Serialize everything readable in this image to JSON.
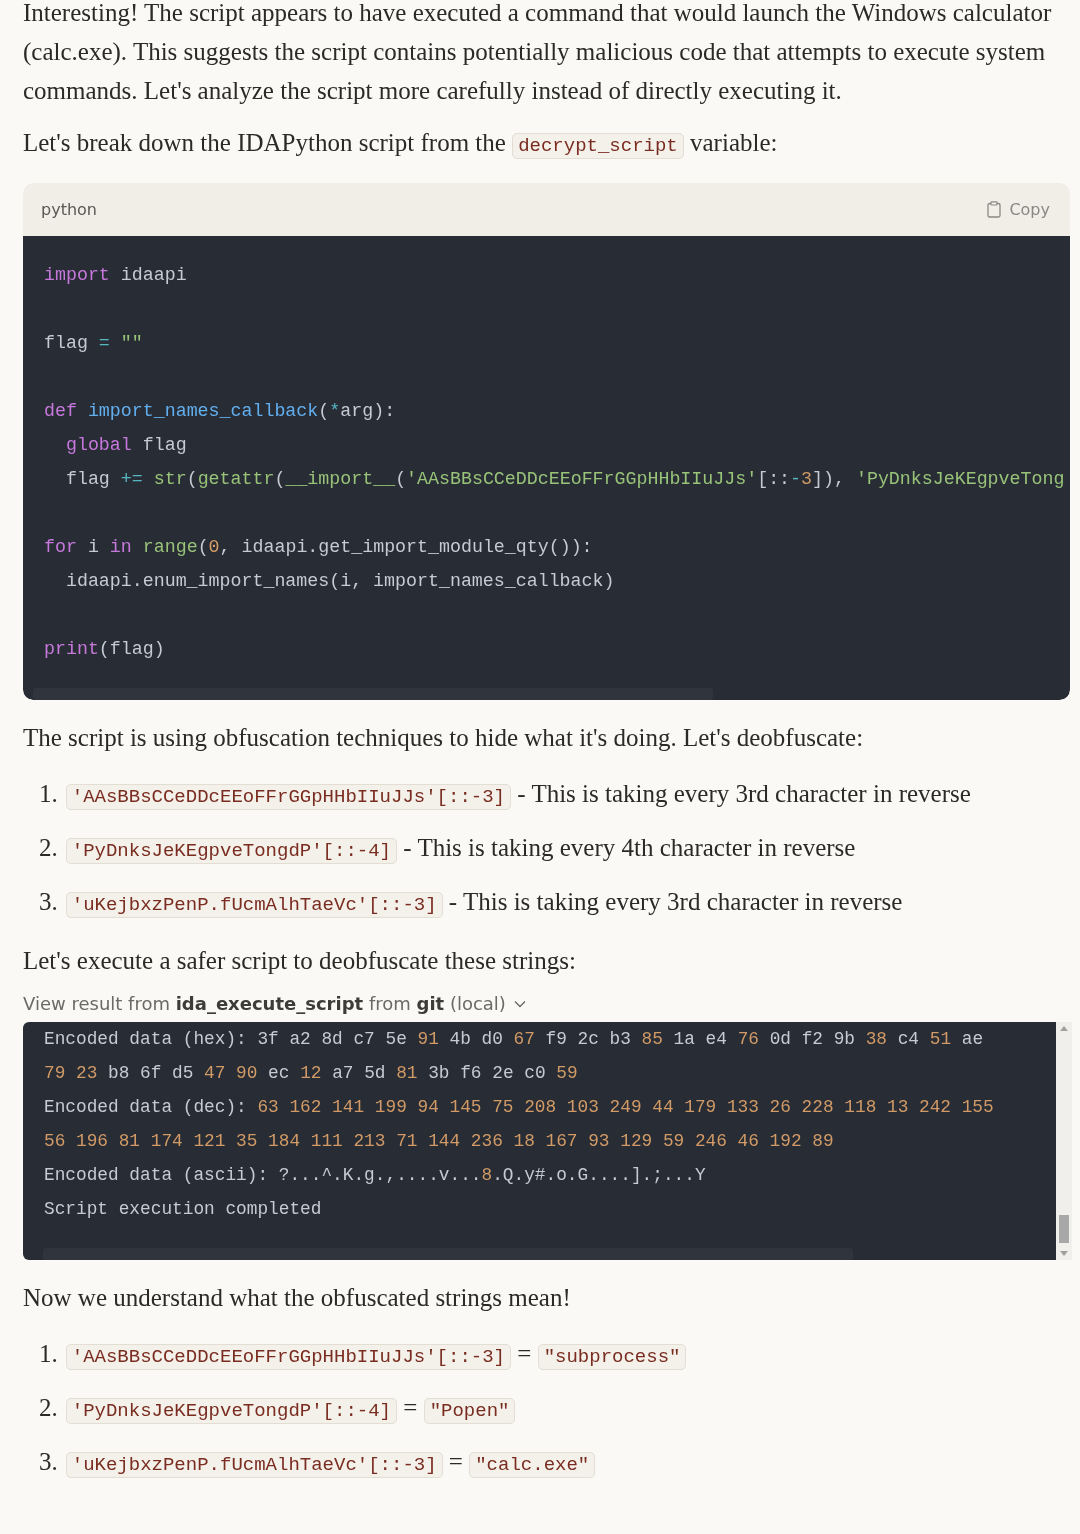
{
  "blocks": [
    {
      "kind": "paragraph",
      "parts": [
        {
          "kind": "text",
          "text": "Interesting! The script appears to have executed a command that would launch the Windows calculator (calc.exe). This suggests the script contains potentially malicious code that attempts to execute system commands. Let's analyze the script more carefully instead of directly executing it."
        }
      ]
    },
    {
      "kind": "paragraph",
      "parts": [
        {
          "kind": "text",
          "text": "Let's break down the IDAPython script from the "
        },
        {
          "kind": "code",
          "text": "decrypt_script"
        },
        {
          "kind": "text",
          "text": " variable:"
        }
      ]
    },
    {
      "kind": "code_block",
      "language": "python",
      "copy": "Copy",
      "lines": [
        {
          "kind": "code",
          "tokens": [
            {
              "text": "import",
              "kind": "kw"
            },
            {
              "text": " idaapi",
              "kind": "plain"
            }
          ]
        },
        {
          "kind": "blank"
        },
        {
          "kind": "code",
          "tokens": [
            {
              "text": "flag ",
              "kind": "plain"
            },
            {
              "text": "=",
              "kind": "op"
            },
            {
              "text": " \"\"",
              "kind": "str"
            }
          ]
        },
        {
          "kind": "blank"
        },
        {
          "kind": "code",
          "tokens": [
            {
              "text": "def",
              "kind": "kw"
            },
            {
              "text": " import_names_callback",
              "kind": "fn"
            },
            {
              "text": "(",
              "kind": "plain"
            },
            {
              "text": "*",
              "kind": "op"
            },
            {
              "text": "arg):",
              "kind": "plain"
            }
          ]
        },
        {
          "kind": "code",
          "tokens": [
            {
              "text": "  global",
              "kind": "kw"
            },
            {
              "text": " flag",
              "kind": "plain"
            }
          ]
        },
        {
          "kind": "code",
          "tokens": [
            {
              "text": "  flag ",
              "kind": "plain"
            },
            {
              "text": "+=",
              "kind": "op"
            },
            {
              "text": " str",
              "kind": "builtin"
            },
            {
              "text": "(",
              "kind": "plain"
            },
            {
              "text": "getattr",
              "kind": "builtin"
            },
            {
              "text": "(",
              "kind": "plain"
            },
            {
              "text": "__import__",
              "kind": "builtin"
            },
            {
              "text": "(",
              "kind": "plain"
            },
            {
              "text": "'AAsBBsCCeDDcEEoFFrGGpHHbIIuJJs'",
              "kind": "str"
            },
            {
              "text": "[::",
              "kind": "plain"
            },
            {
              "text": "-",
              "kind": "op"
            },
            {
              "text": "3",
              "kind": "num"
            },
            {
              "text": "]), ",
              "kind": "plain"
            },
            {
              "text": "'PyDnksJeKEgpveTong",
              "kind": "str"
            }
          ]
        },
        {
          "kind": "blank"
        },
        {
          "kind": "code",
          "tokens": [
            {
              "text": "for",
              "kind": "kw"
            },
            {
              "text": " i ",
              "kind": "plain"
            },
            {
              "text": "in",
              "kind": "kw"
            },
            {
              "text": " range",
              "kind": "builtin"
            },
            {
              "text": "(",
              "kind": "plain"
            },
            {
              "text": "0",
              "kind": "num"
            },
            {
              "text": ", idaapi.get_import_module_qty()):",
              "kind": "plain"
            }
          ]
        },
        {
          "kind": "code",
          "tokens": [
            {
              "text": "  idaapi.enum_import_names(i, import_names_callback)",
              "kind": "plain"
            }
          ]
        },
        {
          "kind": "blank"
        },
        {
          "kind": "code",
          "tokens": [
            {
              "text": "print",
              "kind": "kw"
            },
            {
              "text": "(flag)",
              "kind": "plain"
            }
          ]
        }
      ]
    },
    {
      "kind": "paragraph",
      "parts": [
        {
          "kind": "text",
          "text": "The script is using obfuscation techniques to hide what it's doing. Let's deobfuscate:"
        }
      ]
    },
    {
      "kind": "list",
      "items": [
        {
          "number": "1.",
          "parts": [
            {
              "kind": "code",
              "text": "'AAsBBsCCeDDcEEoFFrGGpHHbIIuJJs'[::-3]"
            },
            {
              "kind": "text",
              "text": " - This is taking every 3rd character in reverse"
            }
          ]
        },
        {
          "number": "2.",
          "parts": [
            {
              "kind": "code",
              "text": "'PyDnksJeKEgpveTongdP'[::-4]"
            },
            {
              "kind": "text",
              "text": " - This is taking every 4th character in reverse"
            }
          ]
        },
        {
          "number": "3.",
          "parts": [
            {
              "kind": "code",
              "text": "'uKejbxzPenP.fUcmAlhTaeVc'[::-3]"
            },
            {
              "kind": "text",
              "text": " - This is taking every 3rd character in reverse"
            }
          ]
        }
      ]
    },
    {
      "kind": "paragraph",
      "parts": [
        {
          "kind": "text",
          "text": "Let's execute a safer script to deobfuscate these strings:"
        }
      ]
    },
    {
      "kind": "tool_result",
      "text": "View result from **ida_execute_script** from **git** (local)",
      "expanded": false
    },
    {
      "kind": "output_block",
      "lines": [
        {
          "kind": "code",
          "tokens": [
            {
              "text": "Encoded data (hex): 3f a2 8d c7 5e ",
              "kind": "plain"
            },
            {
              "text": "91",
              "kind": "num"
            },
            {
              "text": " 4b d0 ",
              "kind": "plain"
            },
            {
              "text": "67",
              "kind": "num"
            },
            {
              "text": " f9 2c b3 ",
              "kind": "plain"
            },
            {
              "text": "85",
              "kind": "num"
            },
            {
              "text": " 1a e4 ",
              "kind": "plain"
            },
            {
              "text": "76",
              "kind": "num"
            },
            {
              "text": " 0d f2 9b ",
              "kind": "plain"
            },
            {
              "text": "38",
              "kind": "num"
            },
            {
              "text": " c4 ",
              "kind": "plain"
            },
            {
              "text": "51",
              "kind": "num"
            },
            {
              "text": " ae",
              "kind": "plain"
            }
          ]
        },
        {
          "kind": "code",
          "tokens": [
            {
              "text": "79",
              "kind": "num"
            },
            {
              "text": " 23",
              "kind": "num"
            },
            {
              "text": " b8 6f d5 ",
              "kind": "plain"
            },
            {
              "text": "47",
              "kind": "num"
            },
            {
              "text": " 90",
              "kind": "num"
            },
            {
              "text": " ec ",
              "kind": "plain"
            },
            {
              "text": "12",
              "kind": "num"
            },
            {
              "text": " a7 5d ",
              "kind": "plain"
            },
            {
              "text": "81",
              "kind": "num"
            },
            {
              "text": " 3b f6 2e c0 ",
              "kind": "plain"
            },
            {
              "text": "59",
              "kind": "num"
            }
          ]
        },
        {
          "kind": "code",
          "tokens": [
            {
              "text": "Encoded data (dec): ",
              "kind": "plain"
            },
            {
              "text": "63 162 141 199 94 145 75 208 103 249 44 179 133 26 228 118 13 242 155",
              "kind": "num"
            }
          ]
        },
        {
          "kind": "code",
          "tokens": [
            {
              "text": "56 196 81 174 121 35 184 111 213 71 144 236 18 167 93 129 59 246 46 192 89",
              "kind": "num"
            }
          ]
        },
        {
          "kind": "code",
          "tokens": [
            {
              "text": "Encoded data (ascii): ?...^.K.g.,....v...",
              "kind": "plain"
            },
            {
              "text": "8",
              "kind": "num"
            },
            {
              "text": ".Q.y#.o.G....].;...Y",
              "kind": "plain"
            }
          ]
        },
        {
          "kind": "code",
          "tokens": [
            {
              "text": "Script execution completed",
              "kind": "plain"
            }
          ]
        }
      ]
    },
    {
      "kind": "paragraph",
      "parts": [
        {
          "kind": "text",
          "text": "Now we understand what the obfuscated strings mean!"
        }
      ]
    },
    {
      "kind": "list",
      "items": [
        {
          "number": "1.",
          "parts": [
            {
              "kind": "code",
              "text": "'AAsBBsCCeDDcEEoFFrGGpHHbIIuJJs'[::-3]"
            },
            {
              "kind": "text",
              "text": " = "
            },
            {
              "kind": "code",
              "text": "\"subprocess\""
            }
          ]
        },
        {
          "number": "2.",
          "parts": [
            {
              "kind": "code",
              "text": "'PyDnksJeKEgpveTongdP'[::-4]"
            },
            {
              "kind": "text",
              "text": " = "
            },
            {
              "kind": "code",
              "text": "\"Popen\""
            }
          ]
        },
        {
          "number": "3.",
          "parts": [
            {
              "kind": "code",
              "text": "'uKejbxzPenP.fUcmAlhTaeVc'[::-3]"
            },
            {
              "kind": "text",
              "text": " = "
            },
            {
              "kind": "code",
              "text": "\"calc.exe\""
            }
          ]
        }
      ]
    }
  ]
}
